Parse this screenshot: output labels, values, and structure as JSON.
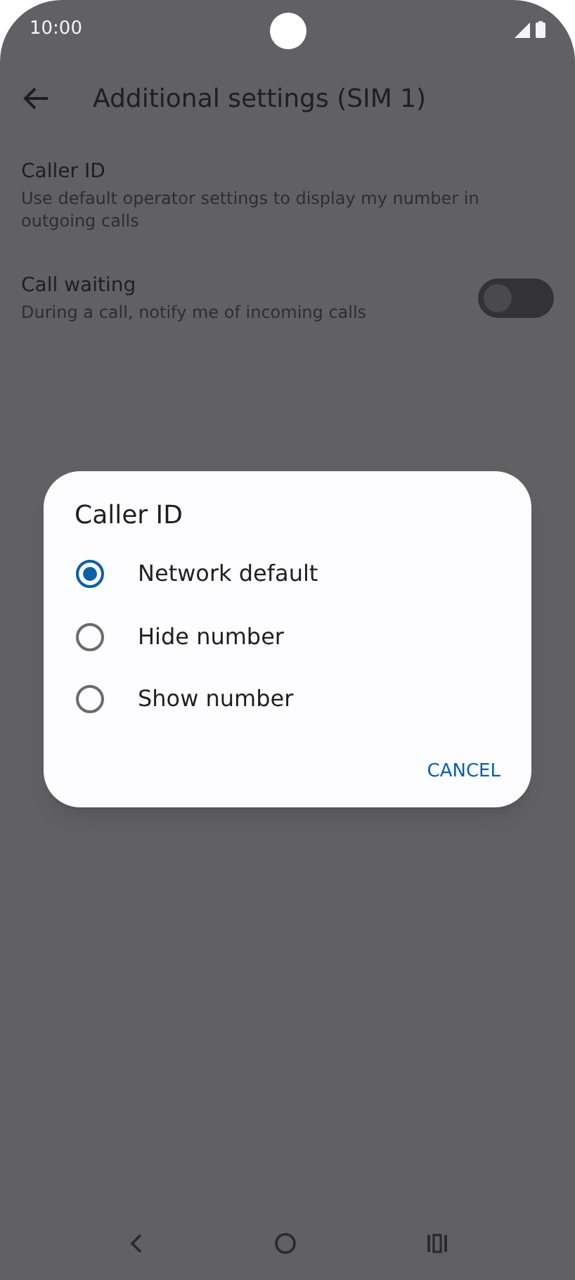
{
  "status_bar": {
    "time": "10:00"
  },
  "app_bar": {
    "title": "Additional settings (SIM 1)"
  },
  "settings": [
    {
      "kind": "text",
      "title": "Caller ID",
      "summary": "Use default operator settings to display my number in outgoing calls"
    },
    {
      "kind": "switch",
      "title": "Call waiting",
      "summary": "During a call, notify me of incoming calls",
      "on": false
    }
  ],
  "dialog": {
    "title": "Caller ID",
    "options": [
      {
        "label": "Network default",
        "selected": true
      },
      {
        "label": "Hide number",
        "selected": false
      },
      {
        "label": "Show number",
        "selected": false
      }
    ],
    "buttons": [
      "CANCEL"
    ]
  }
}
